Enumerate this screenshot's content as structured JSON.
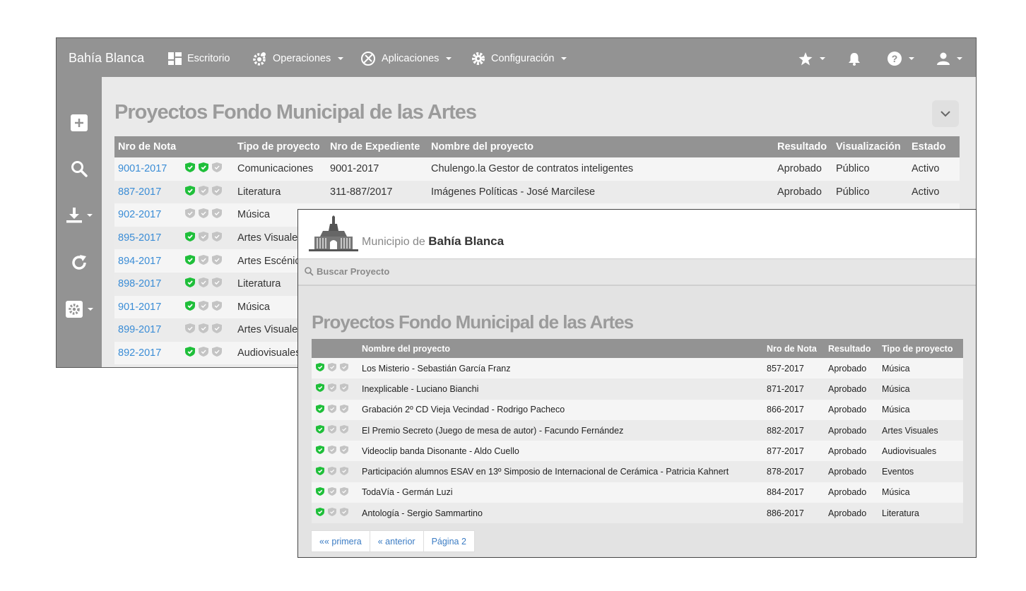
{
  "admin": {
    "brand": "Bahía Blanca",
    "nav": {
      "escritorio": "Escritorio",
      "operaciones": "Operaciones",
      "aplicaciones": "Aplicaciones",
      "configuracion": "Configuración"
    },
    "title": "Proyectos Fondo Municipal de las Artes",
    "columns": [
      "Nro de Nota",
      "",
      "Tipo de proyecto",
      "Nro de Expediente",
      "Nombre del proyecto",
      "Resultado",
      "Visualización",
      "Estado"
    ],
    "rows": [
      {
        "nota": "9001-2017",
        "shields": [
          true,
          true,
          false
        ],
        "tipo": "Comunicaciones",
        "expediente": "9001-2017",
        "nombre": "Chulengo.la Gestor de contratos inteligentes",
        "resultado": "Aprobado",
        "visualizacion": "Público",
        "estado": "Activo"
      },
      {
        "nota": "887-2017",
        "shields": [
          true,
          false,
          false
        ],
        "tipo": "Literatura",
        "expediente": "311-887/2017",
        "nombre": "Imágenes Políticas - José Marcilese",
        "resultado": "Aprobado",
        "visualizacion": "Público",
        "estado": "Activo"
      },
      {
        "nota": "902-2017",
        "shields": [
          false,
          false,
          false
        ],
        "tipo": "Música",
        "expediente": "",
        "nombre": "",
        "resultado": "",
        "visualizacion": "",
        "estado": ""
      },
      {
        "nota": "895-2017",
        "shields": [
          true,
          false,
          false
        ],
        "tipo": "Artes Visuales",
        "expediente": "",
        "nombre": "",
        "resultado": "",
        "visualizacion": "",
        "estado": ""
      },
      {
        "nota": "894-2017",
        "shields": [
          true,
          false,
          false
        ],
        "tipo": "Artes Escénicas",
        "expediente": "",
        "nombre": "",
        "resultado": "",
        "visualizacion": "",
        "estado": ""
      },
      {
        "nota": "898-2017",
        "shields": [
          true,
          false,
          false
        ],
        "tipo": "Literatura",
        "expediente": "",
        "nombre": "",
        "resultado": "",
        "visualizacion": "",
        "estado": ""
      },
      {
        "nota": "901-2017",
        "shields": [
          true,
          false,
          false
        ],
        "tipo": "Música",
        "expediente": "",
        "nombre": "",
        "resultado": "",
        "visualizacion": "",
        "estado": ""
      },
      {
        "nota": "899-2017",
        "shields": [
          false,
          false,
          false
        ],
        "tipo": "Artes Visuales",
        "expediente": "",
        "nombre": "",
        "resultado": "",
        "visualizacion": "",
        "estado": ""
      },
      {
        "nota": "892-2017",
        "shields": [
          true,
          false,
          false
        ],
        "tipo": "Audiovisuales",
        "expediente": "",
        "nombre": "",
        "resultado": "",
        "visualizacion": "",
        "estado": ""
      }
    ]
  },
  "public": {
    "muni_prefix": "Municipio de",
    "muni_name": "Bahía Blanca",
    "search_placeholder": "Buscar Proyecto",
    "title": "Proyectos Fondo Municipal de las Artes",
    "columns": [
      "",
      "Nombre del proyecto",
      "Nro de Nota",
      "Resultado",
      "Tipo de proyecto"
    ],
    "rows": [
      {
        "shields": [
          true,
          false,
          false
        ],
        "nombre": "Los Misterio - Sebastián García Franz",
        "nota": "857-2017",
        "resultado": "Aprobado",
        "tipo": "Música"
      },
      {
        "shields": [
          true,
          false,
          false
        ],
        "nombre": "Inexplicable - Luciano Bianchi",
        "nota": "871-2017",
        "resultado": "Aprobado",
        "tipo": "Música"
      },
      {
        "shields": [
          true,
          false,
          false
        ],
        "nombre": "Grabación 2º CD Vieja Vecindad - Rodrigo Pacheco",
        "nota": "866-2017",
        "resultado": "Aprobado",
        "tipo": "Música"
      },
      {
        "shields": [
          true,
          false,
          false
        ],
        "nombre": "El Premio Secreto (Juego de mesa de autor) - Facundo Fernández",
        "nota": "882-2017",
        "resultado": "Aprobado",
        "tipo": "Artes Visuales"
      },
      {
        "shields": [
          true,
          false,
          false
        ],
        "nombre": "Videoclip banda Disonante - Aldo Cuello",
        "nota": "877-2017",
        "resultado": "Aprobado",
        "tipo": "Audiovisuales"
      },
      {
        "shields": [
          true,
          false,
          false
        ],
        "nombre": "Participación alumnos ESAV en 13º Simposio de Internacional de Cerámica - Patricia Kahnert",
        "nota": "878-2017",
        "resultado": "Aprobado",
        "tipo": "Eventos"
      },
      {
        "shields": [
          true,
          false,
          false
        ],
        "nombre": "TodaVía - Germán Luzi",
        "nota": "884-2017",
        "resultado": "Aprobado",
        "tipo": "Música"
      },
      {
        "shields": [
          true,
          false,
          false
        ],
        "nombre": "Antología - Sergio Sammartino",
        "nota": "886-2017",
        "resultado": "Aprobado",
        "tipo": "Literatura"
      }
    ],
    "pager": [
      "«« primera",
      "« anterior",
      "Página 2"
    ]
  },
  "colors": {
    "header_gray": "#939393",
    "link_blue": "#3b8dd6",
    "shield_green": "#1fbf3a",
    "shield_gray": "#c4c4c4"
  }
}
